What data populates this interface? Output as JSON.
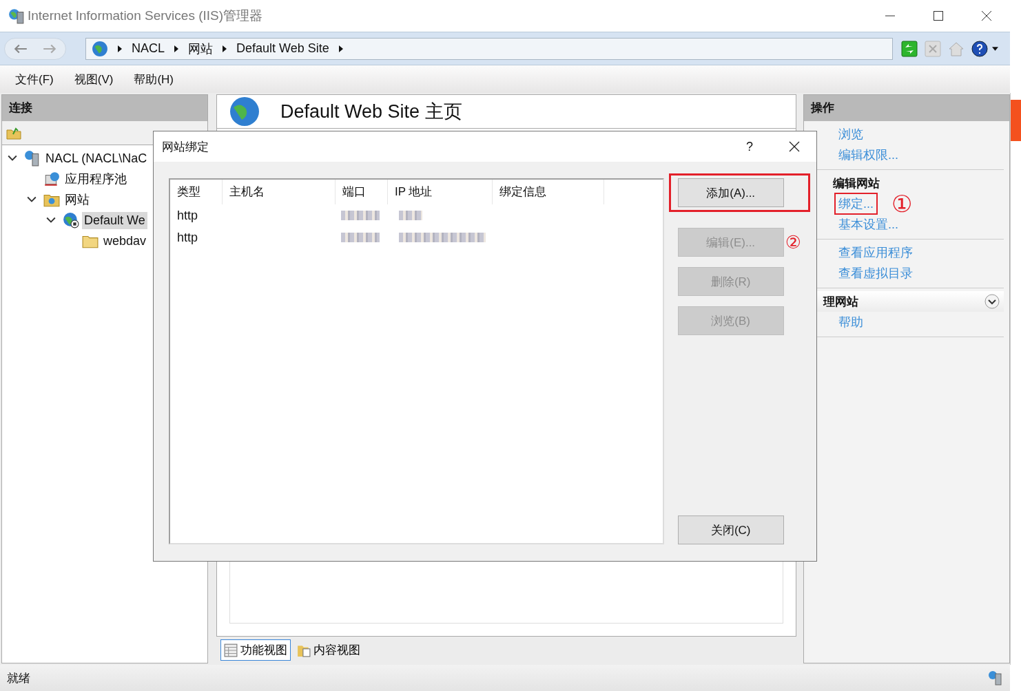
{
  "window": {
    "title": "Internet Information Services (IIS)管理器"
  },
  "address_bar": {
    "crumbs": [
      "NACL",
      "网站",
      "Default Web Site"
    ]
  },
  "menu": [
    {
      "label": "文件(F)"
    },
    {
      "label": "视图(V)"
    },
    {
      "label": "帮助(H)"
    }
  ],
  "connections": {
    "title": "连接",
    "tree": [
      {
        "label": "NACL (NACL\\NaC",
        "kind": "server",
        "expanded": true,
        "selected": false,
        "children": [
          {
            "label": "应用程序池",
            "kind": "pool",
            "selected": false
          },
          {
            "label": "网站",
            "kind": "sites",
            "expanded": true,
            "selected": false,
            "children": [
              {
                "label": "Default We",
                "kind": "site",
                "expanded": true,
                "selected": true,
                "children": [
                  {
                    "label": "webdav",
                    "kind": "folder",
                    "selected": false
                  }
                ]
              }
            ]
          }
        ]
      }
    ]
  },
  "home": {
    "title": "Default Web Site 主页"
  },
  "view_tabs": [
    {
      "label": "功能视图",
      "selected": true
    },
    {
      "label": "内容视图",
      "selected": false
    }
  ],
  "actions": {
    "title": "操作",
    "groups": [
      {
        "items": [
          {
            "label": "浏览",
            "highlighted": false
          },
          {
            "label": "编辑权限...",
            "highlighted": false
          }
        ]
      },
      {
        "title": "编辑网站",
        "items": [
          {
            "label": "绑定...",
            "highlighted": true,
            "marker": "①"
          },
          {
            "label": "基本设置...",
            "highlighted": false
          }
        ]
      },
      {
        "items": [
          {
            "label": "查看应用程序",
            "highlighted": false
          },
          {
            "label": "查看虚拟目录",
            "highlighted": false
          }
        ]
      },
      {
        "title": "理网站",
        "collapsible": true,
        "items": [
          {
            "label": "帮助",
            "highlighted": false
          }
        ]
      }
    ]
  },
  "dialog": {
    "title": "网站绑定",
    "help": "?",
    "columns": [
      "类型",
      "主机名",
      "端口",
      "IP 地址",
      "绑定信息"
    ],
    "rows": [
      {
        "type": "http",
        "redacted": true
      },
      {
        "type": "http",
        "redacted": true
      }
    ],
    "buttons": [
      {
        "label": "添加(A)...",
        "disabled": false,
        "highlighted": true
      },
      {
        "label": "编辑(E)...",
        "disabled": true,
        "highlighted": false,
        "marker": "②"
      },
      {
        "label": "删除(R)",
        "disabled": true,
        "highlighted": false
      },
      {
        "label": "浏览(B)",
        "disabled": true,
        "highlighted": false
      }
    ],
    "close_button": {
      "label": "关闭(C)"
    }
  },
  "status_bar": {
    "text": "就绪"
  }
}
